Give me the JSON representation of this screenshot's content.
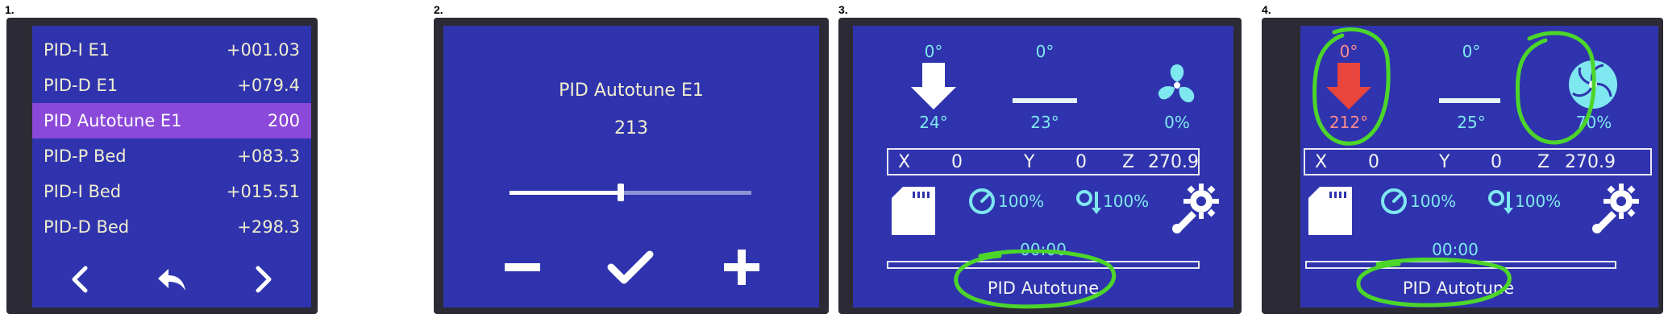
{
  "panels": {
    "p1": {
      "number": "1.",
      "menu": [
        {
          "label": "PID-I E1",
          "value": "+001.03"
        },
        {
          "label": "PID-D E1",
          "value": "+079.4"
        },
        {
          "label": "PID Autotune E1",
          "value": "200"
        },
        {
          "label": "PID-P Bed",
          "value": "+083.3"
        },
        {
          "label": "PID-I Bed",
          "value": "+015.51"
        },
        {
          "label": "PID-D Bed",
          "value": "+298.3"
        }
      ],
      "selected_index": 2,
      "nav_icons": [
        "chevron-left-icon",
        "back-icon",
        "chevron-right-icon"
      ]
    },
    "p2": {
      "number": "2.",
      "title": "PID Autotune E1",
      "value": "213",
      "slider_fraction": 0.46,
      "buttons": [
        "minus-icon",
        "check-icon",
        "plus-icon"
      ]
    },
    "p3": {
      "number": "3.",
      "hotend_target": "0°",
      "hotend_current": "24°",
      "bed_target": "0°",
      "bed_current": "23°",
      "fan_percent": "0%",
      "axes": {
        "x_label": "X",
        "x": "0",
        "y_label": "Y",
        "y": "0",
        "z_label": "Z",
        "z": "270.9"
      },
      "speed_percent": "100%",
      "flow_percent": "100%",
      "elapsed": "00:00",
      "progress_fraction": 0,
      "message": "PID Autotune"
    },
    "p4": {
      "number": "4.",
      "hotend_target": "0°",
      "hotend_current": "212°",
      "bed_target": "0°",
      "bed_current": "25°",
      "fan_percent": "70%",
      "axes": {
        "x_label": "X",
        "x": "0",
        "y_label": "Y",
        "y": "0",
        "z_label": "Z",
        "z": "270.9"
      },
      "speed_percent": "100%",
      "flow_percent": "100%",
      "elapsed": "00:00",
      "progress_fraction": 0,
      "message": "PID Autotune"
    }
  },
  "colors": {
    "screen_bg": "#2f34ae",
    "selected_row": "#8a49d9",
    "accent_cyan": "#7fe7ef",
    "hot_red": "#e8453c",
    "annotation_green": "#4cd62a"
  }
}
